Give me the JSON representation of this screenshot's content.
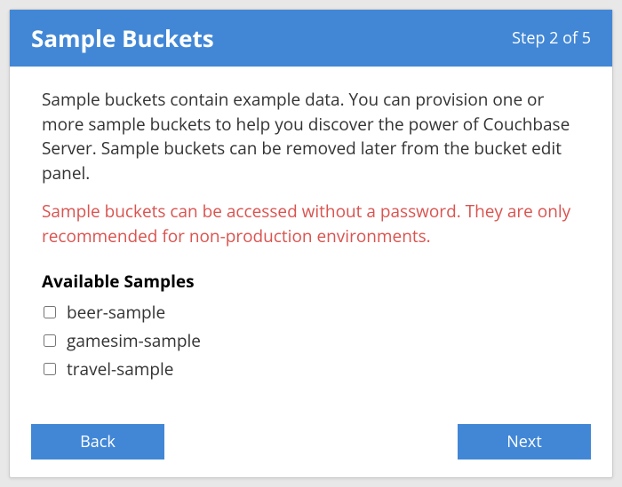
{
  "header": {
    "title": "Sample Buckets",
    "step_label": "Step 2 of 5"
  },
  "body": {
    "description": "Sample buckets contain example data. You can provision one or more sample buckets to help you discover the power of Couchbase Server. Sample buckets can be removed later from the bucket edit panel.",
    "warning": "Sample buckets can be accessed without a password. They are only recommended for non-production environments.",
    "section_heading": "Available Samples",
    "samples": [
      {
        "label": "beer-sample"
      },
      {
        "label": "gamesim-sample"
      },
      {
        "label": "travel-sample"
      }
    ]
  },
  "footer": {
    "back_label": "Back",
    "next_label": "Next"
  }
}
